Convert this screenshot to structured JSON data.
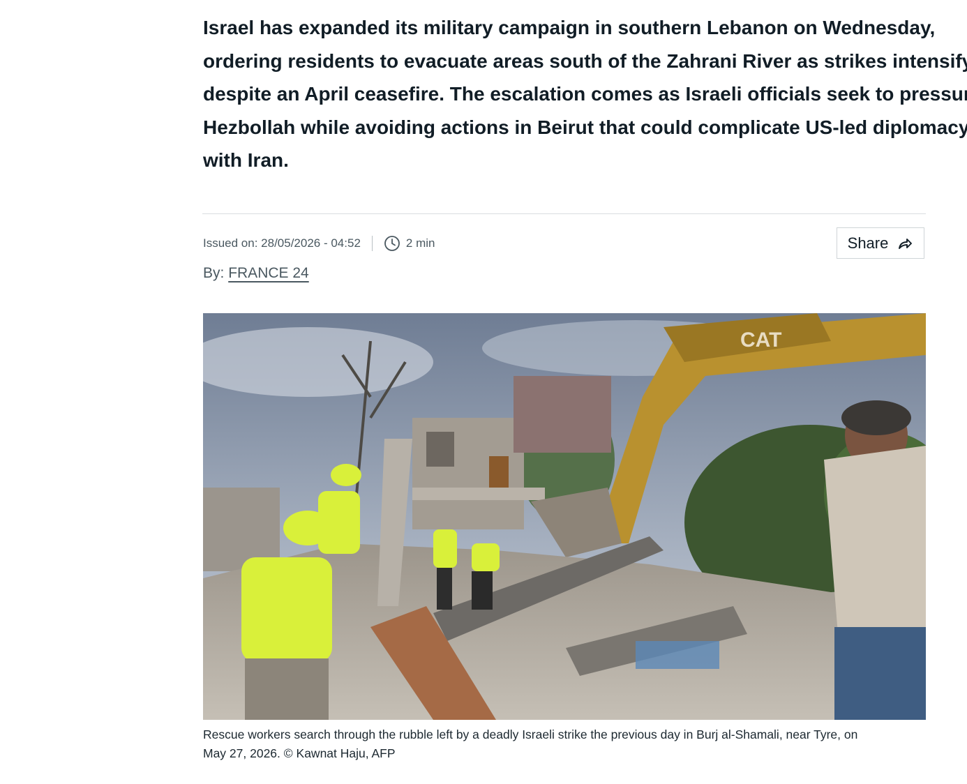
{
  "article": {
    "lede_lines": [
      "Israel has expanded its military campaign in southern Lebanon on Wednesday,",
      "ordering residents to evacuate areas south of the Zahrani River as strikes intensify",
      "despite an April ceasefire. The escalation comes as Israeli officials seek to pressure",
      "Hezbollah while avoiding actions in Beirut that could complicate US-led diplomacy",
      "with Iran."
    ],
    "issued_on": "Issued on: 28/05/2026 - 04:52",
    "read_time": "2 min",
    "share_label": "Share",
    "byline_prefix": "By:",
    "byline_author": "FRANCE 24",
    "photo_caption_line1": "Rescue workers search through the rubble left by a deadly Israeli strike the previous day in Burj al-Shamali, near Tyre, on",
    "photo_caption_line2": "May 27, 2026.  © Kawnat Haju, AFP",
    "photo_logo_text": "CAT"
  },
  "icons": {
    "clock": "clock-icon",
    "share": "share-arrow-icon"
  },
  "colors": {
    "text": "#111d26",
    "muted": "#4a5860",
    "divider": "#dadde0",
    "vest": "#d9f03a"
  }
}
